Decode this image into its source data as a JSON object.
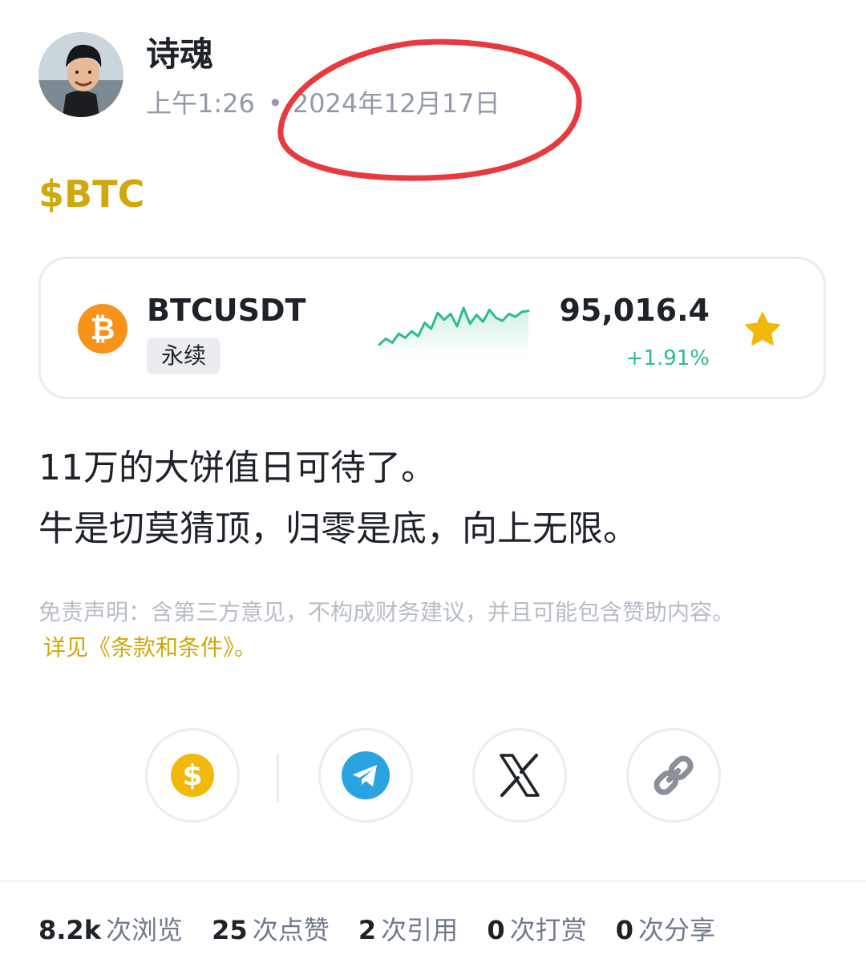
{
  "author": {
    "name": "诗魂",
    "time": "上午1:26",
    "separator": "•",
    "date": "2024年12月17日"
  },
  "cashtag": "$BTC",
  "ticker": {
    "symbol": "BTCUSDT",
    "contract_type": "永续",
    "coin_glyph": "₿",
    "price": "95,016.4",
    "change": "+1.91%",
    "up_color": "#2ebd85",
    "brand_color": "#f7931a",
    "favorited": true,
    "trend_values": [
      0.18,
      0.3,
      0.22,
      0.4,
      0.32,
      0.45,
      0.35,
      0.62,
      0.5,
      0.82,
      0.68,
      0.8,
      0.55,
      0.92,
      0.6,
      0.78,
      0.64,
      0.88,
      0.72,
      0.66,
      0.8,
      0.74,
      0.84,
      0.86
    ]
  },
  "post": {
    "lines": [
      "11万的大饼值日可待了。",
      "牛是切莫猜顶，归零是底，向上无限。"
    ]
  },
  "disclaimer": {
    "text": "免责声明：含第三方意见，不构成财务建议，并且可能包含赞助内容。",
    "terms_link": "详见《条款和条件》。"
  },
  "actions": [
    {
      "name": "tip",
      "icon": "dollar-coin-icon"
    },
    {
      "name": "telegram",
      "icon": "telegram-icon"
    },
    {
      "name": "x",
      "icon": "x-logo-icon"
    },
    {
      "name": "copy-link",
      "icon": "link-icon"
    }
  ],
  "stats": {
    "views": {
      "count": "8.2k",
      "label": "次浏览"
    },
    "likes": {
      "count": "25",
      "label": "次点赞"
    },
    "quotes": {
      "count": "2",
      "label": "次引用"
    },
    "tips": {
      "count": "0",
      "label": "次打赏"
    },
    "shares": {
      "count": "0",
      "label": "次分享"
    }
  },
  "colors": {
    "accent_gold": "#d0a80b",
    "annotation_red": "#e8393f",
    "text_primary": "#1e2329",
    "text_muted": "#929aa5"
  }
}
